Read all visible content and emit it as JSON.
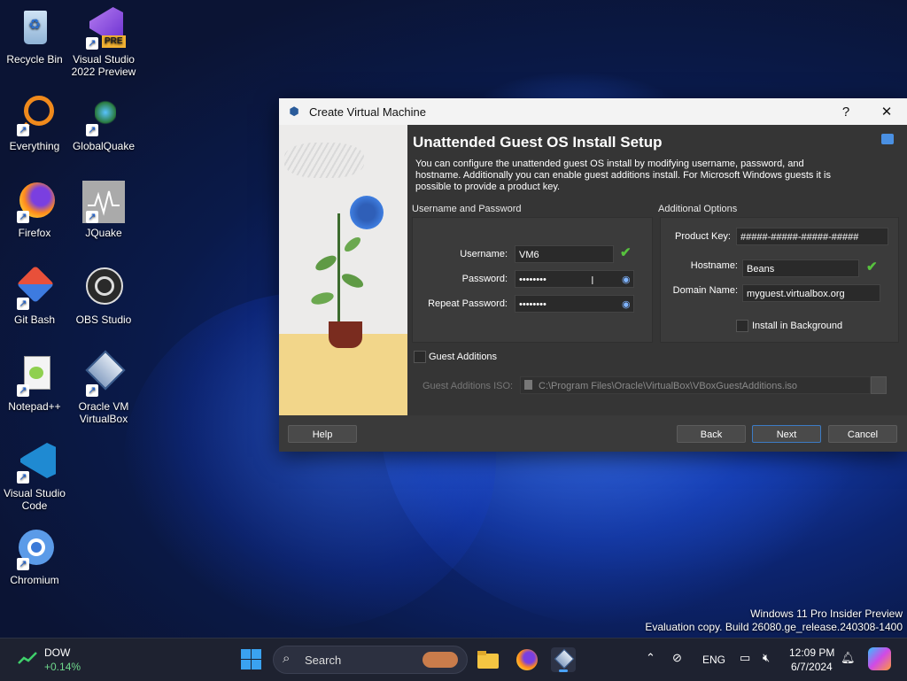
{
  "desktop": {
    "icons": [
      {
        "label": "Recycle Bin",
        "icon": "recycle-bin-icon"
      },
      {
        "label": "Visual Studio 2022 Preview",
        "icon": "visual-studio-preview-icon",
        "badge": "PRE"
      },
      {
        "label": "Everything",
        "icon": "everything-search-icon"
      },
      {
        "label": "GlobalQuake",
        "icon": "globalquake-icon"
      },
      {
        "label": "Firefox",
        "icon": "firefox-icon"
      },
      {
        "label": "JQuake",
        "icon": "jquake-icon"
      },
      {
        "label": "Git Bash",
        "icon": "git-bash-icon"
      },
      {
        "label": "OBS Studio",
        "icon": "obs-studio-icon"
      },
      {
        "label": "Notepad++",
        "icon": "notepad-plus-plus-icon"
      },
      {
        "label": "Oracle VM VirtualBox",
        "icon": "virtualbox-icon"
      },
      {
        "label": "Visual Studio Code",
        "icon": "vscode-icon"
      },
      {
        "label": "Chromium",
        "icon": "chromium-icon"
      }
    ],
    "watermark_line1": "Windows 11 Pro Insider Preview",
    "watermark_line2": "Evaluation copy. Build 26080.ge_release.240308-1400"
  },
  "dialog": {
    "window_title": "Create Virtual Machine",
    "help_glyph": "?",
    "close_glyph": "✕",
    "heading": "Unattended Guest OS Install Setup",
    "description": "You can configure the unattended guest OS install by modifying username, password, and hostname. Additionally you can enable guest additions install. For Microsoft Windows guests it is possible to provide a product key.",
    "user_group_title": "Username and Password",
    "username_label": "Username:",
    "username_value": "VM6",
    "password_label": "Password:",
    "password_value": "••••••••",
    "repeat_password_label": "Repeat Password:",
    "repeat_password_value": "••••••••",
    "additional_group_title": "Additional Options",
    "product_key_label": "Product Key:",
    "product_key_value": "#####-#####-#####-#####",
    "hostname_label": "Hostname:",
    "hostname_value": "Beans",
    "domain_label": "Domain Name:",
    "domain_value": "myguest.virtualbox.org",
    "install_background_label": "Install in Background",
    "guest_additions_label": "Guest Additions",
    "guest_additions_iso_label": "Guest Additions ISO:",
    "guest_additions_iso_value": "C:\\Program Files\\Oracle\\VirtualBox\\VBoxGuestAdditions.iso",
    "help_button": "Help",
    "back_button": "Back",
    "next_button": "Next",
    "cancel_button": "Cancel"
  },
  "taskbar": {
    "stock_name": "DOW",
    "stock_change": "+0.14%",
    "search_placeholder": "Search",
    "language": "ENG",
    "time": "12:09 PM",
    "date": "6/7/2024",
    "accent_color": "#0078d4"
  }
}
